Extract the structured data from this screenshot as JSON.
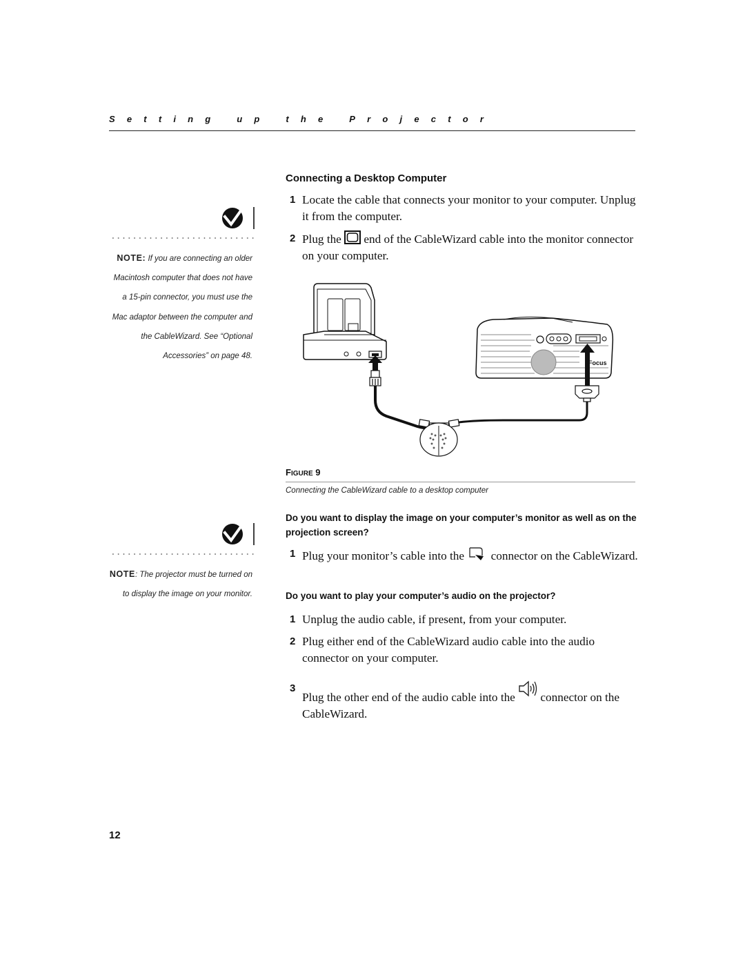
{
  "running_head": "Setting up the Projector",
  "notes": [
    {
      "label": "NOTE:",
      "text": " If you are connecting an older Macintosh computer that does not have a 15-pin connector, you must use the Mac adaptor between the computer and the CableWizard. See “Optional Accessories” on page 48.",
      "icon": "note-checkmark-icon"
    },
    {
      "label": "NOTE",
      "text": ": The projector must be turned on to display the image on your monitor.",
      "icon": "note-checkmark-icon"
    }
  ],
  "section": {
    "title": "Connecting a Desktop Computer",
    "steps": [
      {
        "number": "1",
        "text": "Locate the cable that connects your monitor to your computer. Unplug it from the computer."
      },
      {
        "number": "2",
        "text_before": "Plug the ",
        "icon": "monitor-connector-icon",
        "text_after": " end of the CableWizard cable into the monitor connector on your computer."
      }
    ]
  },
  "figure": {
    "label_prefix": "F",
    "label_smallcaps": "IGURE",
    "label_number": " 9",
    "caption": "Connecting the CableWizard cable to a desktop computer",
    "brand_text": "Focus"
  },
  "questions": [
    {
      "text": "Do you want to display the image on your computer’s monitor as well as on the projection screen?",
      "steps": [
        {
          "number": "1",
          "text_before": "Plug your monitor’s cable into the ",
          "icon": "monitor-out-connector-icon",
          "text_after": " connector on the CableWizard."
        }
      ]
    },
    {
      "text": "Do you want to play your computer’s audio on the projector?",
      "steps": [
        {
          "number": "1",
          "text": "Unplug the audio cable, if present, from your computer."
        },
        {
          "number": "2",
          "text": "Plug either end of the CableWizard audio cable into the audio connector on your computer."
        },
        {
          "number": "3",
          "text_before": "Plug the other end of the audio cable into the ",
          "icon": "speaker-icon",
          "text_after": " connector on the CableWizard."
        }
      ]
    }
  ],
  "page_number": "12"
}
